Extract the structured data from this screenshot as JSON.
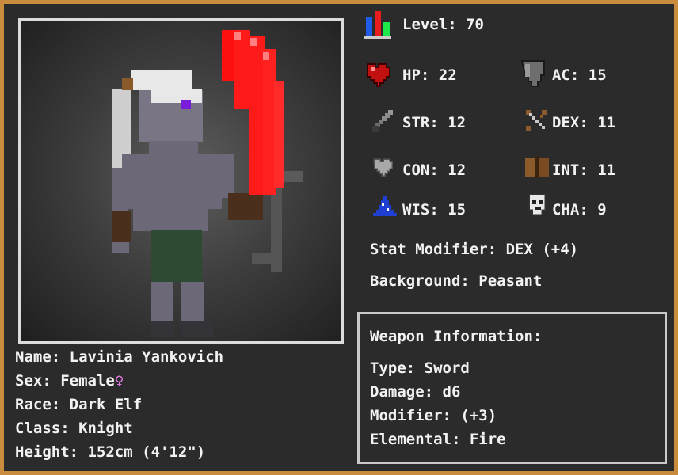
{
  "level": {
    "label": "Level: 70"
  },
  "stats": {
    "hp": "HP: 22",
    "ac": "AC: 15",
    "str": "STR: 12",
    "dex": "DEX: 11",
    "con": "CON: 12",
    "int": "INT: 11",
    "wis": "WIS: 15",
    "cha": "CHA: 9"
  },
  "stat_modifier": "Stat Modifier: DEX (+4)",
  "background": "Background: Peasant",
  "character": {
    "name": "Name: Lavinia Yankovich",
    "sex": "Sex: Female",
    "sex_symbol": "♀",
    "race": "Race: Dark Elf",
    "class": "Class: Knight",
    "height": "Height: 152cm (4'12\")"
  },
  "weapon": {
    "title": "Weapon Information:",
    "type": "Type: Sword",
    "damage": "Damage: d6",
    "modifier": "Modifier: (+3)",
    "elemental": "Elemental: Fire"
  },
  "colors": {
    "frame": "#c98b3d",
    "panel": "#2b2b2b",
    "text": "#f2f2f2",
    "female": "#e67ce6",
    "fire_blade": "#ff1010"
  },
  "icons": {
    "level": "level-bars-icon",
    "hp": "heart-icon",
    "ac": "shield-icon",
    "str": "sword-icon",
    "dex": "bow-icon",
    "con": "grey-heart-icon",
    "int": "book-icon",
    "wis": "wizard-hat-icon",
    "cha": "mask-icon"
  }
}
